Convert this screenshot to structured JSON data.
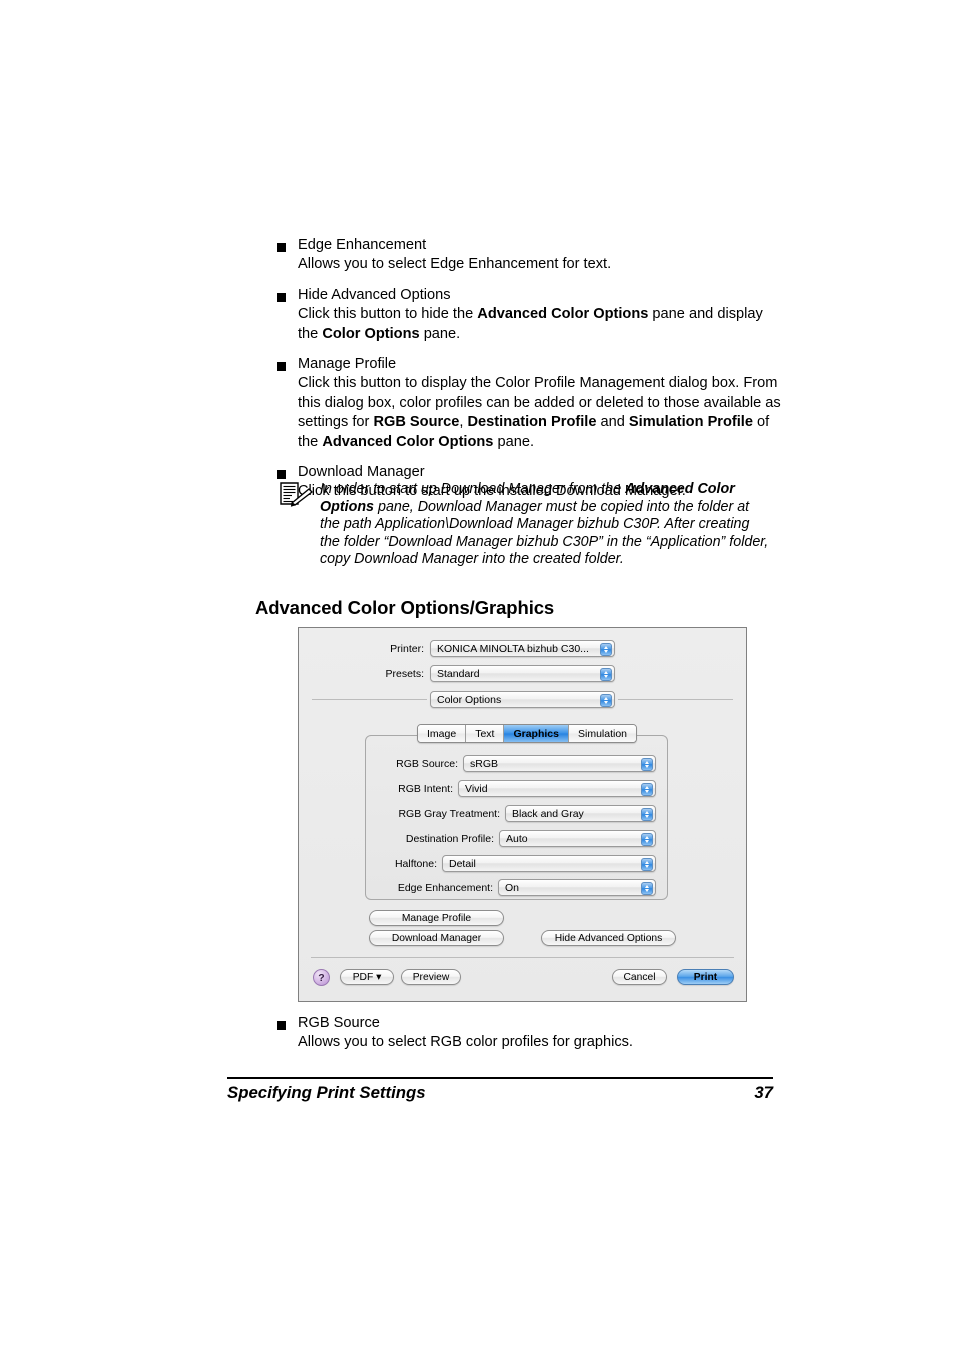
{
  "bullets": [
    {
      "title": "Edge Enhancement",
      "desc_html": "Allows you to select Edge Enhancement for text."
    },
    {
      "title": "Hide Advanced Options",
      "desc_html": "Click this button to hide the <b>Advanced Color Options</b> pane and display the <b>Color Options</b> pane."
    },
    {
      "title": "Manage Profile",
      "desc_html": "Click this button to display the Color Profile Management dialog box. From this dialog box, color profiles can be added or deleted to those available as settings for <b>RGB Source</b>, <b>Destination Profile</b> and <b>Simulation Profile</b> of the <b>Advanced Color Options</b> pane."
    },
    {
      "title": "Download Manager",
      "desc_html": "Click this button to start up the installed Download Manager."
    }
  ],
  "note": {
    "icon": "note-memo-icon",
    "text_html": "In order to start up Download Manager from the <b>Advanced Color Options</b> pane, Download Manager must be copied into the folder at the path Application\\Download Manager bizhub C30P. After creating the folder “Download Manager bizhub C30P” in the “Application” folder, copy Download Manager into the created folder."
  },
  "section": {
    "heading": "Advanced Color Options/Graphics"
  },
  "dialog": {
    "printer": {
      "label": "Printer:",
      "value": "KONICA MINOLTA bizhub C30..."
    },
    "presets": {
      "label": "Presets:",
      "value": "Standard"
    },
    "pane_popup": {
      "value": "Color Options"
    },
    "tabs": [
      {
        "label": "Image",
        "active": false
      },
      {
        "label": "Text",
        "active": false
      },
      {
        "label": "Graphics",
        "active": true
      },
      {
        "label": "Simulation",
        "active": false
      }
    ],
    "fields": [
      {
        "label": "RGB Source:",
        "value": "sRGB"
      },
      {
        "label": "RGB Intent:",
        "value": "Vivid"
      },
      {
        "label": "RGB Gray Treatment:",
        "value": "Black and Gray"
      },
      {
        "label": "Destination Profile:",
        "value": "Auto"
      },
      {
        "label": "Halftone:",
        "value": "Detail"
      },
      {
        "label": "Edge Enhancement:",
        "value": "On"
      }
    ],
    "pane_buttons": {
      "manage_profile": "Manage Profile",
      "download_manager": "Download Manager",
      "hide_advanced_options": "Hide Advanced Options"
    },
    "actions": {
      "help": "?",
      "pdf": "PDF ▾",
      "preview": "Preview",
      "cancel": "Cancel",
      "print": "Print"
    },
    "colors": {
      "accent_blue": "#2782e1",
      "help_purple": "#b890d3",
      "dialog_bg": "#ededed"
    }
  },
  "trailing_bullet": {
    "title": "RGB Source",
    "desc_html": "Allows you to select RGB color profiles for graphics."
  },
  "footer": {
    "title": "Specifying Print Settings",
    "page": "37"
  }
}
